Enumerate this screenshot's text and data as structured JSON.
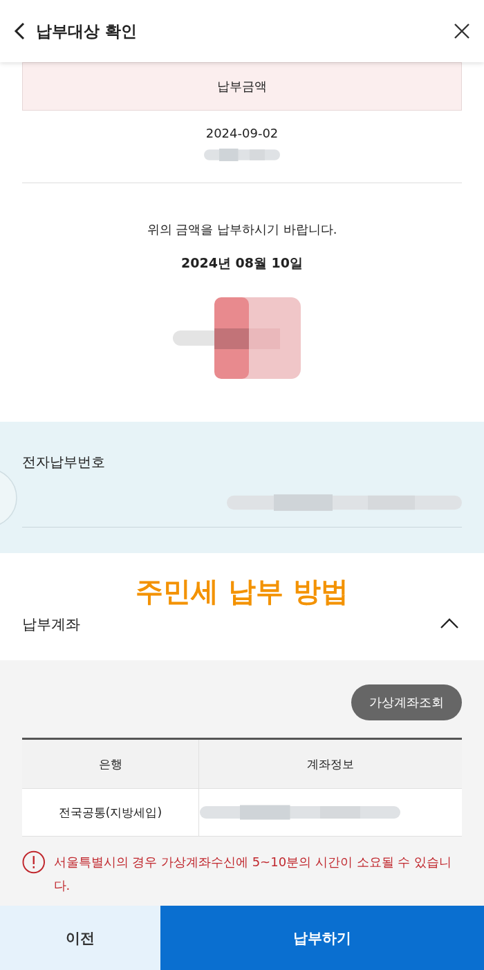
{
  "header": {
    "title": "납부대상 확인"
  },
  "amount_table": {
    "column": "납부금액",
    "date": "2024-09-02"
  },
  "notice": {
    "text": "위의 금액을 납부하시기 바랍니다.",
    "date": "2024년 08월 10일"
  },
  "payment_number": {
    "label": "전자납부번호"
  },
  "caption": "주민세 납부 방법",
  "account_section": {
    "title": "납부계좌",
    "expanded": true,
    "lookup_button": "가상계좌조회",
    "columns": [
      "은행",
      "계좌정보"
    ],
    "rows": [
      {
        "bank": "전국공통(지방세입)"
      }
    ],
    "warning": "서울특별시의 경우 가상계좌수신에 5~10분의 시간이 소요될 수 있습니다."
  },
  "footer": {
    "buttons": [
      "이전",
      "납부하기"
    ]
  }
}
